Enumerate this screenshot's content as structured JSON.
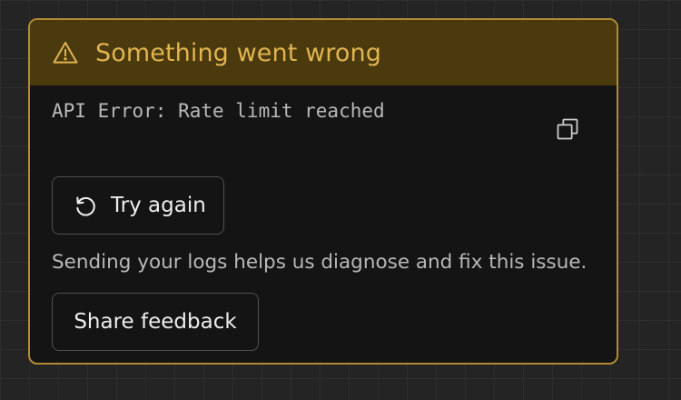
{
  "error_card": {
    "header": {
      "icon": "warning-triangle-icon",
      "title": "Something went wrong"
    },
    "error_message": "API Error: Rate limit reached",
    "copy_button_icon": "copy-icon",
    "try_again": {
      "icon": "retry-icon",
      "label": "Try again"
    },
    "info_text": "Sending your logs helps us diagnose and fix this issue.",
    "share_feedback": {
      "label": "Share feedback"
    }
  },
  "colors": {
    "header_background": "#4a3a0e",
    "header_text": "#e0b44f",
    "card_border": "#b48a34",
    "card_background": "#141414",
    "page_background": "#242424"
  }
}
